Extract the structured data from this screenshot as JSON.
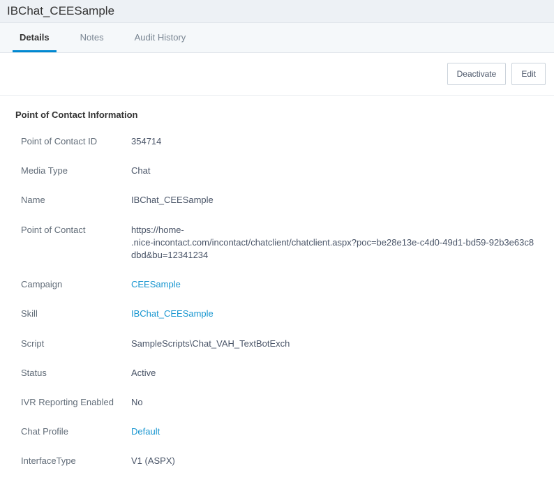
{
  "title": "IBChat_CEESample",
  "tabs": [
    {
      "label": "Details",
      "active": true
    },
    {
      "label": "Notes",
      "active": false
    },
    {
      "label": "Audit History",
      "active": false
    }
  ],
  "actions": {
    "deactivate": "Deactivate",
    "edit": "Edit"
  },
  "section_title": "Point of Contact Information",
  "fields": {
    "poc_id_label": "Point of Contact ID",
    "poc_id_value": "354714",
    "media_type_label": "Media Type",
    "media_type_value": "Chat",
    "name_label": "Name",
    "name_value": "IBChat_CEESample",
    "poc_label": "Point of Contact",
    "poc_value_prefix": "https://home-",
    "poc_value_suffix": ".nice-incontact.com/incontact/chatclient/chatclient.aspx?poc=be28e13e-c4d0-49d1-bd59-92b3e63c8dbd&bu=12341234",
    "campaign_label": "Campaign",
    "campaign_value": "CEESample",
    "skill_label": "Skill",
    "skill_value": "IBChat_CEESample",
    "script_label": "Script",
    "script_value": "SampleScripts\\Chat_VAH_TextBotExch",
    "status_label": "Status",
    "status_value": "Active",
    "ivr_label": "IVR Reporting Enabled",
    "ivr_value": "No",
    "chat_profile_label": "Chat Profile",
    "chat_profile_value": "Default",
    "interface_type_label": "InterfaceType",
    "interface_type_value": "V1 (ASPX)"
  }
}
